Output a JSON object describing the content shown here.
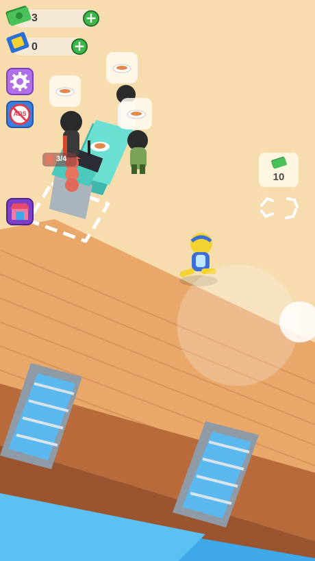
{
  "hud": {
    "cash": {
      "icon": "cash-icon",
      "value": "3",
      "add_label": "+"
    },
    "tickets": {
      "icon": "ticket-icon",
      "value": "0",
      "add_label": "+"
    }
  },
  "side_buttons": {
    "settings": {
      "icon": "gear-icon"
    },
    "no_ads": {
      "icon": "no-ads-icon",
      "label": "ADS"
    },
    "shop": {
      "icon": "shop-icon"
    }
  },
  "station": {
    "stock_icon": "octopus-icon",
    "stock": "3/4"
  },
  "reward": {
    "icon": "cash-icon",
    "value": "10"
  },
  "customer_orders": {
    "icon": "dish-icon",
    "count": 3
  },
  "colors": {
    "floor": "#e9a86a",
    "sand": "#f7dcae",
    "counter": "#5fd6c8",
    "water": "#3fa8e8",
    "cash_green": "#3eb74a",
    "settings_purple": "#b06ee8",
    "no_ads_red": "#e03a4a"
  }
}
